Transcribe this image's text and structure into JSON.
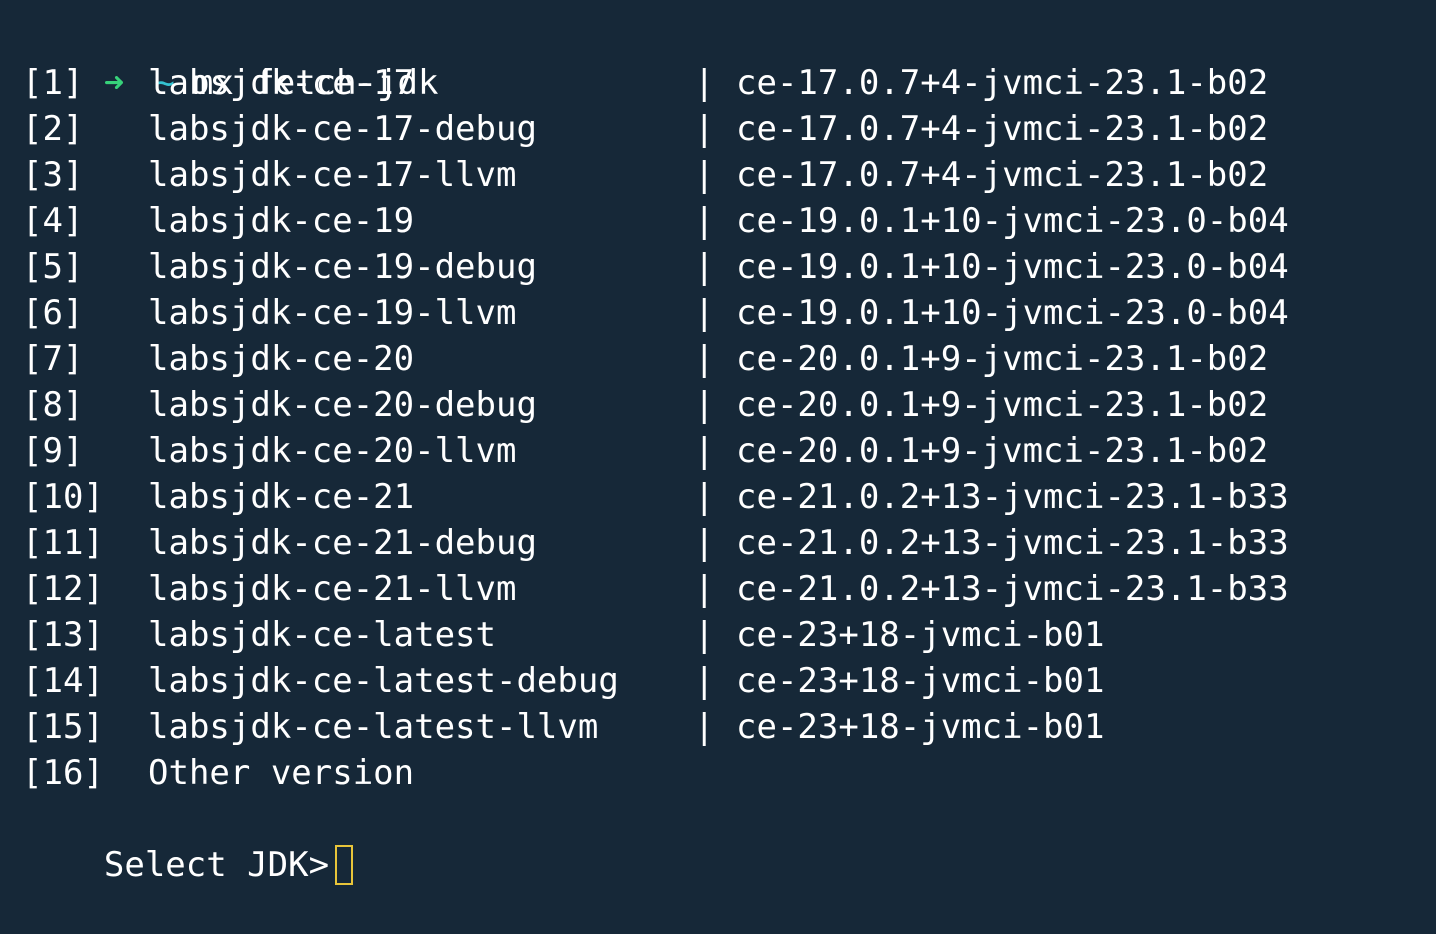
{
  "prompt": {
    "arrow": "➜",
    "dir": "~",
    "command": "mx fetch-jdk"
  },
  "separator": "|",
  "options": [
    {
      "index": "[1]",
      "name": "labsjdk-ce-17",
      "version": "ce-17.0.7+4-jvmci-23.1-b02"
    },
    {
      "index": "[2]",
      "name": "labsjdk-ce-17-debug",
      "version": "ce-17.0.7+4-jvmci-23.1-b02"
    },
    {
      "index": "[3]",
      "name": "labsjdk-ce-17-llvm",
      "version": "ce-17.0.7+4-jvmci-23.1-b02"
    },
    {
      "index": "[4]",
      "name": "labsjdk-ce-19",
      "version": "ce-19.0.1+10-jvmci-23.0-b04"
    },
    {
      "index": "[5]",
      "name": "labsjdk-ce-19-debug",
      "version": "ce-19.0.1+10-jvmci-23.0-b04"
    },
    {
      "index": "[6]",
      "name": "labsjdk-ce-19-llvm",
      "version": "ce-19.0.1+10-jvmci-23.0-b04"
    },
    {
      "index": "[7]",
      "name": "labsjdk-ce-20",
      "version": "ce-20.0.1+9-jvmci-23.1-b02"
    },
    {
      "index": "[8]",
      "name": "labsjdk-ce-20-debug",
      "version": "ce-20.0.1+9-jvmci-23.1-b02"
    },
    {
      "index": "[9]",
      "name": "labsjdk-ce-20-llvm",
      "version": "ce-20.0.1+9-jvmci-23.1-b02"
    },
    {
      "index": "[10]",
      "name": "labsjdk-ce-21",
      "version": "ce-21.0.2+13-jvmci-23.1-b33"
    },
    {
      "index": "[11]",
      "name": "labsjdk-ce-21-debug",
      "version": "ce-21.0.2+13-jvmci-23.1-b33"
    },
    {
      "index": "[12]",
      "name": "labsjdk-ce-21-llvm",
      "version": "ce-21.0.2+13-jvmci-23.1-b33"
    },
    {
      "index": "[13]",
      "name": "labsjdk-ce-latest",
      "version": "ce-23+18-jvmci-b01"
    },
    {
      "index": "[14]",
      "name": "labsjdk-ce-latest-debug",
      "version": "ce-23+18-jvmci-b01"
    },
    {
      "index": "[15]",
      "name": "labsjdk-ce-latest-llvm",
      "version": "ce-23+18-jvmci-b01"
    }
  ],
  "other": {
    "index": "[16]",
    "name": "Other version"
  },
  "input": {
    "label": "Select JDK>",
    "value": ""
  },
  "colors": {
    "background": "#162838",
    "text": "#ffffff",
    "arrow": "#37d27a",
    "tilde": "#34c3d1",
    "cursor": "#e8c53a"
  }
}
